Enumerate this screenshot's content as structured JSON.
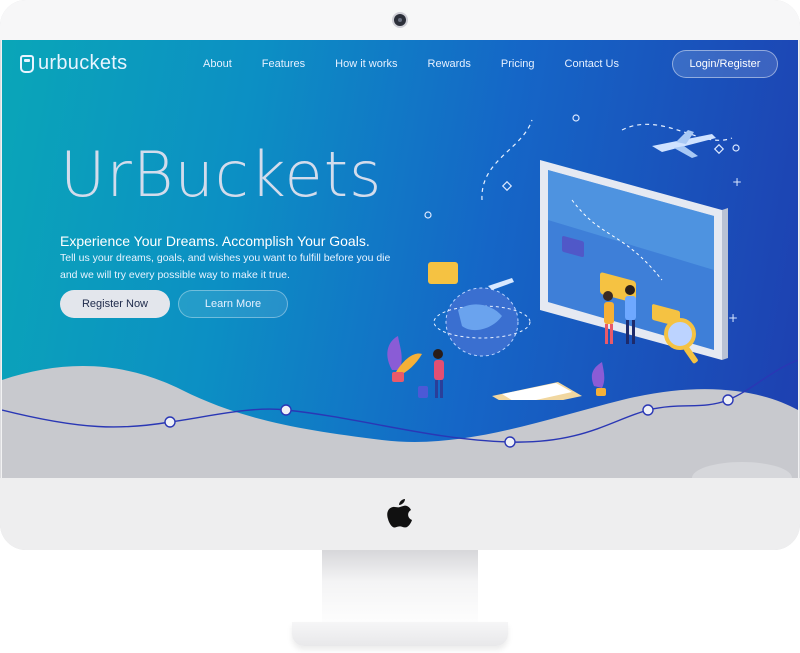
{
  "brand": {
    "name": "urbuckets",
    "logo_icon": "bucket-icon"
  },
  "nav": {
    "items": [
      {
        "label": "About"
      },
      {
        "label": "Features"
      },
      {
        "label": "How it works"
      },
      {
        "label": "Rewards"
      },
      {
        "label": "Pricing"
      },
      {
        "label": "Contact Us"
      }
    ],
    "login_label": "Login/Register"
  },
  "hero": {
    "title": "UrBuckets",
    "tagline": "Experience Your Dreams. Accomplish Your Goals.",
    "description": "Tell us your dreams, goals, and wishes you want to fulfill before you die and we will try every possible way to make it true.",
    "primary_cta": "Register Now",
    "secondary_cta": "Learn More"
  },
  "colors": {
    "gradient_start": "#0aa6b8",
    "gradient_end": "#1e3fb0",
    "wave": "#c8c9ce",
    "wave_line": "#2a37b5"
  },
  "icons": [
    "bucket-icon",
    "apple-logo-icon",
    "webcam-icon",
    "airplane-icon",
    "globe-icon",
    "magnifier-icon",
    "clipboard-icon"
  ]
}
